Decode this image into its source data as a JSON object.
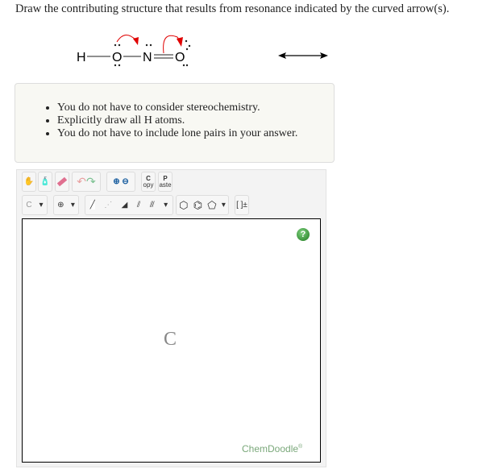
{
  "question": "Draw the contributing structure that results from resonance indicated by the curved arrow(s).",
  "molecule": {
    "atoms": [
      "H",
      "O",
      "N",
      "O"
    ]
  },
  "instructions": [
    "You do not have to consider stereochemistry.",
    "Explicitly draw all H atoms.",
    "You do not have to include lone pairs in your answer."
  ],
  "toolbar": {
    "copy_top": "C",
    "copy_bottom": "opy",
    "paste_top": "P",
    "paste_bottom": "aste",
    "element": "C",
    "charge_label": "[ ]±"
  },
  "canvas": {
    "placeholder_atom": "C",
    "help": "?",
    "brand": "ChemDoodle",
    "brand_mark": "®"
  },
  "colors": {
    "arrow": "#e00000",
    "brand": "#7aa87a"
  }
}
